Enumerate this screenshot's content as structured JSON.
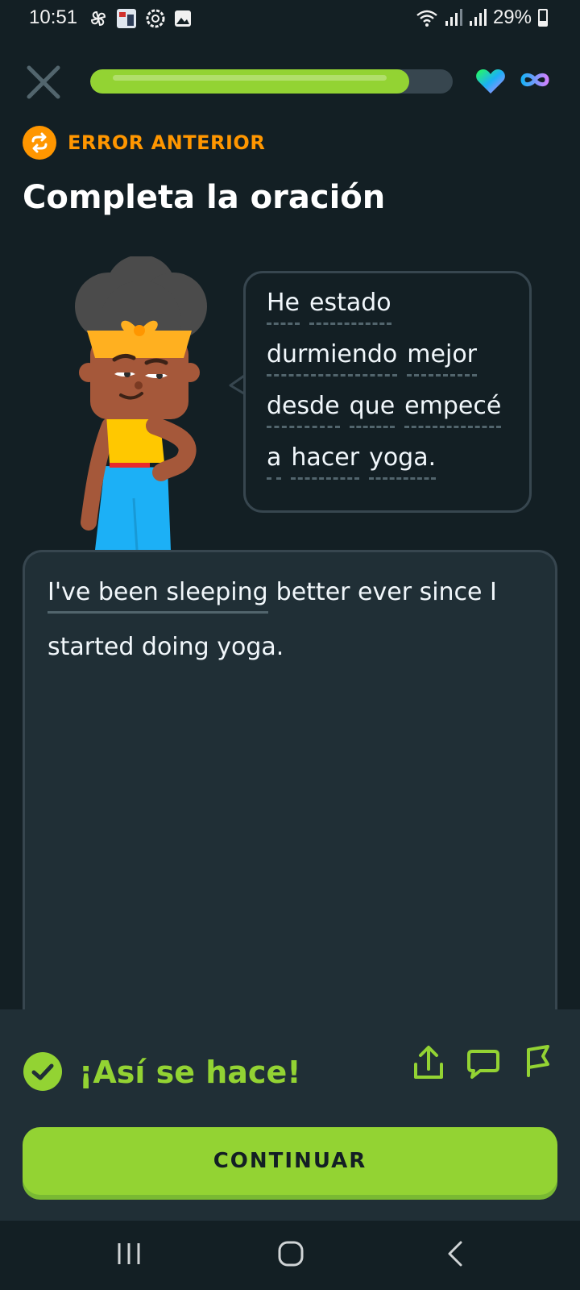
{
  "status_bar": {
    "time": "10:51",
    "battery_percent": "29%",
    "battery_level": 0.29
  },
  "top_bar": {
    "progress": 0.88,
    "colors": {
      "progress_fill": "#93d333",
      "progress_track": "#37464f"
    }
  },
  "header": {
    "label": "ERROR ANTERIOR",
    "title": "Completa la oración",
    "label_color": "#ff9600"
  },
  "speech_bubble": {
    "lines": [
      [
        "He",
        "estado"
      ],
      [
        "durmiendo",
        "mejor"
      ],
      [
        "desde",
        "que",
        "empecé"
      ],
      [
        "a",
        "hacer",
        "yoga."
      ]
    ]
  },
  "answer": {
    "chip": "I've been sleeping",
    "line1_rest": "better ever since I",
    "line2": "started doing yoga."
  },
  "feedback": {
    "message": "¡Así se hace!",
    "continue_label": "CONTINUAR",
    "color": "#93d333"
  },
  "icons": {
    "close": "close-icon",
    "heart": "heart-icon",
    "infinity": "infinity-icon",
    "repeat": "repeat-icon",
    "check": "check-circle-icon",
    "share": "share-icon",
    "comment": "comment-icon",
    "flag": "flag-icon"
  }
}
